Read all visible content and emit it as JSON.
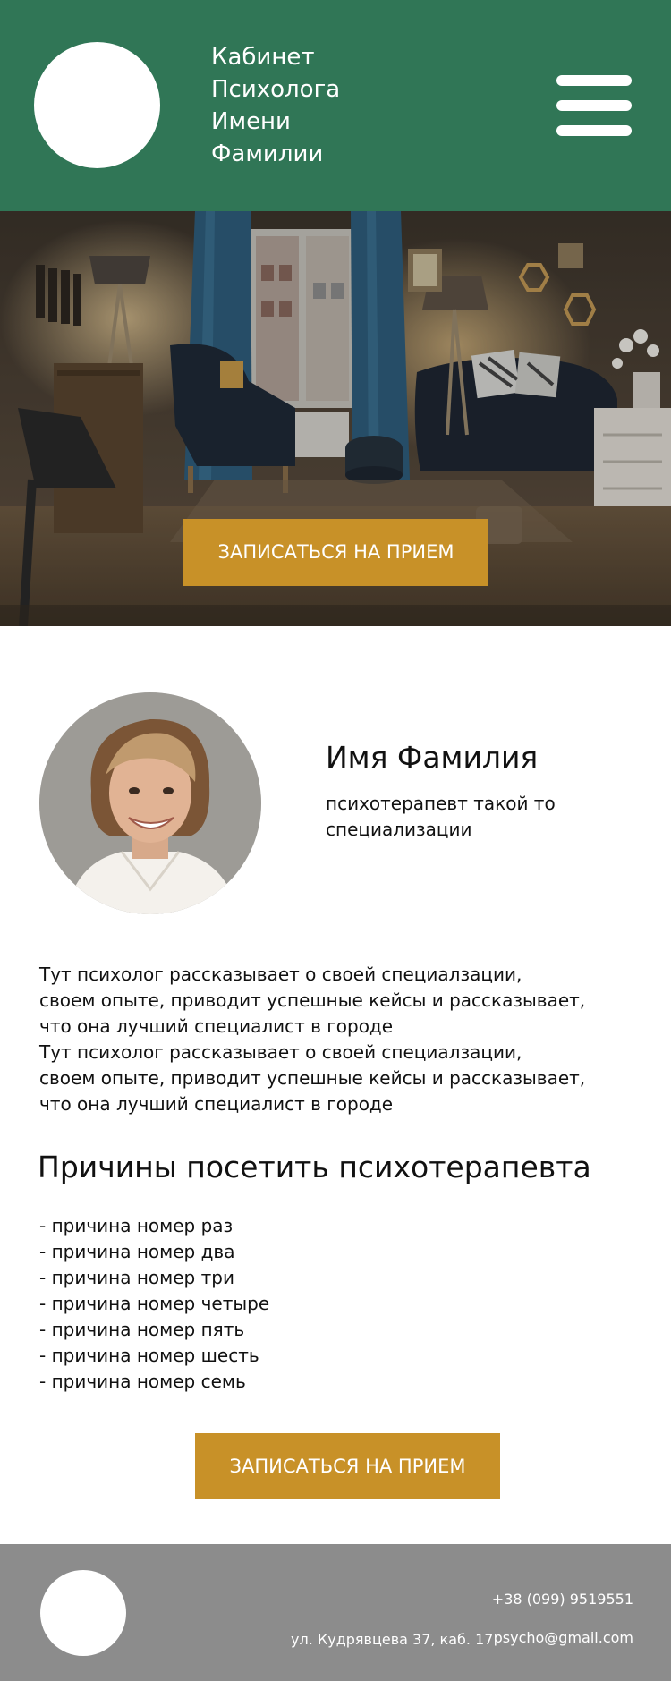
{
  "header": {
    "title_lines": [
      "Кабинет",
      "Психолога",
      "Имени",
      "Фамилии"
    ]
  },
  "hero": {
    "button_label": "ЗАПИСАТЬСЯ НА ПРИЕМ"
  },
  "profile": {
    "name": "Имя Фамилия",
    "title": "психотерапевт такой то специализации"
  },
  "bio": {
    "lines": [
      "Тут психолог рассказывает о своей специалзации,",
      "своем опыте, приводит успешные кейсы и рассказывает,",
      "что она лучший специалист в городе",
      "Тут психолог рассказывает о своей специалзации,",
      "своем опыте, приводит успешные кейсы и рассказывает,",
      "что она лучший специалист в городе"
    ]
  },
  "reasons": {
    "heading": "Причины посетить психотерапевта",
    "items": [
      "- причина номер раз",
      "- причина номер два",
      "- причина номер три",
      "- причина номер четыре",
      "- причина номер пять",
      "- причина номер шесть",
      "- причина номер семь"
    ]
  },
  "cta": {
    "button_label": "ЗАПИСАТЬСЯ НА ПРИЕМ"
  },
  "footer": {
    "phone": "+38 (099) 9519551",
    "address": "ул. Кудрявцева 37, каб. 17",
    "email": "psycho@gmail.com"
  },
  "colors": {
    "header_bg": "#307656",
    "button_bg": "#c89128",
    "footer_bg": "#8c8c8c",
    "text": "#111111"
  },
  "icons": {
    "menu": "hamburger-menu-icon"
  }
}
